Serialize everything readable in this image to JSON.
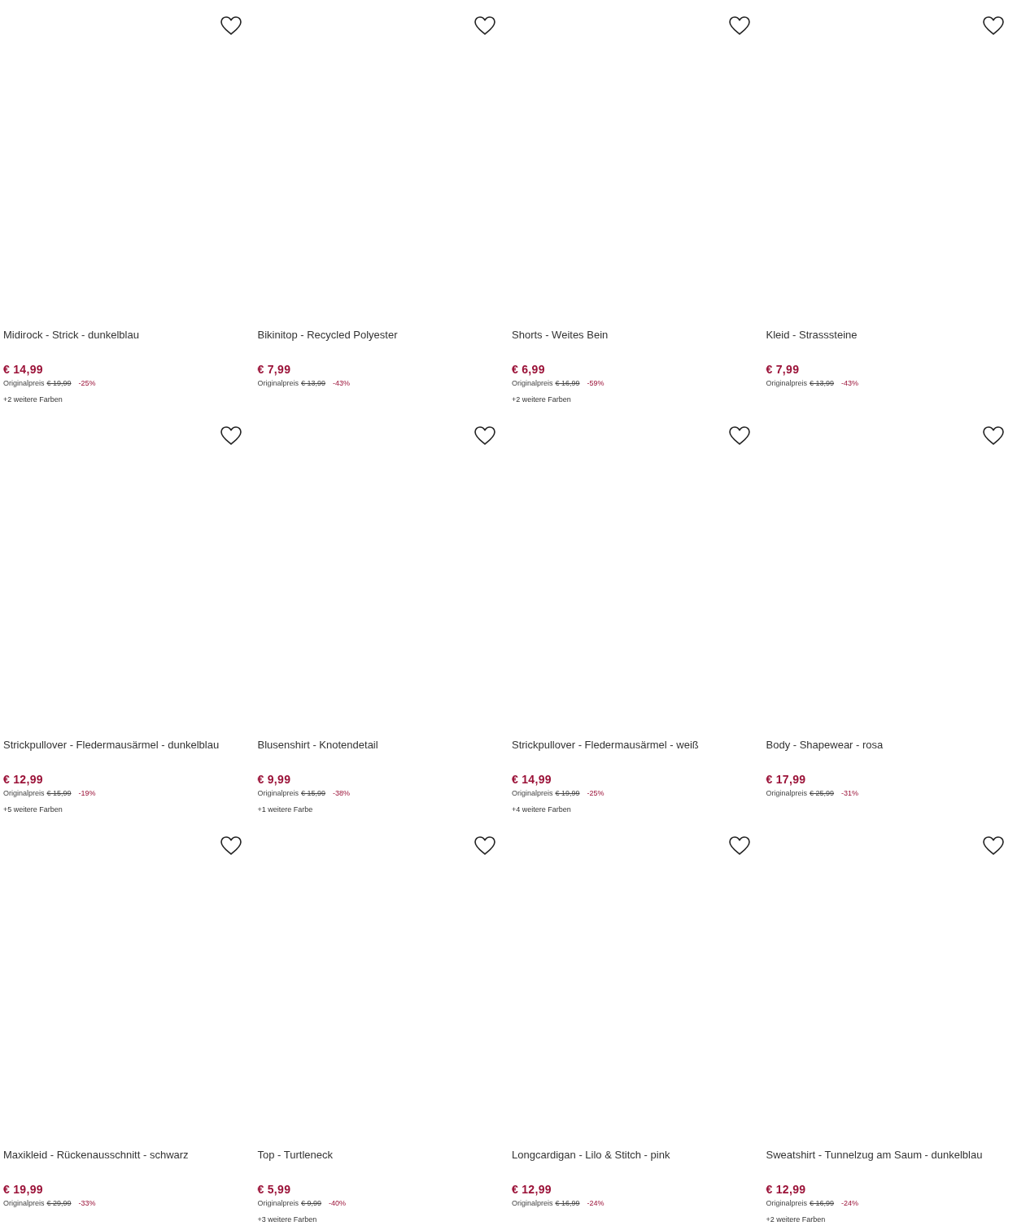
{
  "products": [
    {
      "title": "Midirock - Strick - dunkelblau",
      "price": "€ 14,99",
      "original_label": "Originalpreis",
      "original_price": "€ 19,99",
      "discount": "-25%",
      "more_colors": "+2 weitere Farben"
    },
    {
      "title": "Bikinitop - Recycled Polyester",
      "price": "€ 7,99",
      "original_label": "Originalpreis",
      "original_price": "€ 13,99",
      "discount": "-43%"
    },
    {
      "title": "Shorts - Weites Bein",
      "price": "€ 6,99",
      "original_label": "Originalpreis",
      "original_price": "€ 16,99",
      "discount": "-59%",
      "more_colors": "+2 weitere Farben"
    },
    {
      "title": "Kleid - Strasssteine",
      "price": "€ 7,99",
      "original_label": "Originalpreis",
      "original_price": "€ 13,99",
      "discount": "-43%"
    },
    {
      "title": "Strickpullover - Fledermausärmel - dunkelblau",
      "price": "€ 12,99",
      "original_label": "Originalpreis",
      "original_price": "€ 15,99",
      "discount": "-19%",
      "more_colors": "+5 weitere Farben"
    },
    {
      "title": "Blusenshirt - Knotendetail",
      "price": "€ 9,99",
      "original_label": "Originalpreis",
      "original_price": "€ 15,99",
      "discount": "-38%",
      "more_colors": "+1 weitere Farbe"
    },
    {
      "title": "Strickpullover - Fledermausärmel - weiß",
      "price": "€ 14,99",
      "original_label": "Originalpreis",
      "original_price": "€ 19,99",
      "discount": "-25%",
      "more_colors": "+4 weitere Farben"
    },
    {
      "title": "Body - Shapewear - rosa",
      "price": "€ 17,99",
      "original_label": "Originalpreis",
      "original_price": "€ 25,99",
      "discount": "-31%"
    },
    {
      "title": "Maxikleid - Rückenausschnitt - schwarz",
      "price": "€ 19,99",
      "original_label": "Originalpreis",
      "original_price": "€ 29,99",
      "discount": "-33%"
    },
    {
      "title": "Top - Turtleneck",
      "price": "€ 5,99",
      "original_label": "Originalpreis",
      "original_price": "€ 9,99",
      "discount": "-40%",
      "more_colors": "+3 weitere Farben"
    },
    {
      "title": "Longcardigan - Lilo & Stitch - pink",
      "price": "€ 12,99",
      "original_label": "Originalpreis",
      "original_price": "€ 16,99",
      "discount": "-24%"
    },
    {
      "title": "Sweatshirt - Tunnelzug am Saum - dunkelblau",
      "price": "€ 12,99",
      "original_label": "Originalpreis",
      "original_price": "€ 16,99",
      "discount": "-24%",
      "more_colors": "+2 weitere Farben"
    }
  ]
}
